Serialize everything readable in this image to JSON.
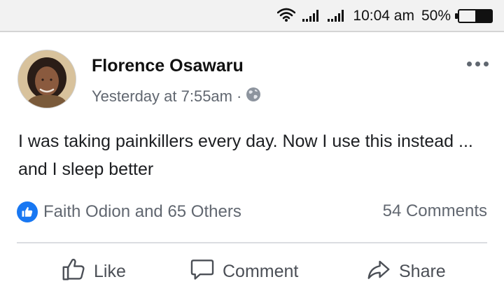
{
  "status_bar": {
    "time": "10:04 am",
    "battery_percent": "50%",
    "battery_level": 0.5,
    "icons": [
      "wifi-icon",
      "signal-icon",
      "signal-icon",
      "battery-icon"
    ]
  },
  "post": {
    "author": "Florence Osawaru",
    "timestamp": "Yesterday at 7:55am",
    "separator": "·",
    "privacy_icon": "globe-icon",
    "text": "I was taking painkillers every day. Now I use this instead ... and I sleep better",
    "reactions_text": "Faith Odion and 65 Others",
    "comments_text": "54 Comments"
  },
  "actions": {
    "like": "Like",
    "comment": "Comment",
    "share": "Share"
  },
  "colors": {
    "like_blue": "#1877f2",
    "muted_text": "#616770",
    "status_bar_bg": "#f2f2f2"
  }
}
